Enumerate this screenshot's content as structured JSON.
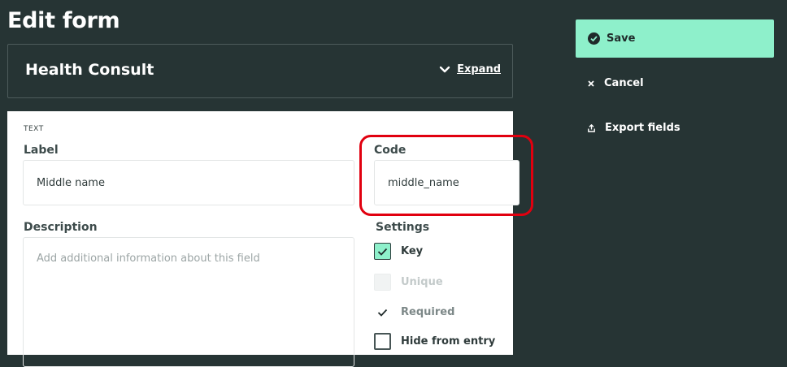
{
  "page": {
    "title": "Edit form"
  },
  "form": {
    "name": "Health Consult",
    "expand_label": "Expand"
  },
  "field": {
    "type_tag": "TEXT",
    "label_heading": "Label",
    "label_value": "Middle name",
    "code_heading": "Code",
    "code_value": "middle_name",
    "description_heading": "Description",
    "description_placeholder": "Add additional information about this field"
  },
  "settings": {
    "heading": "Settings",
    "items": [
      {
        "label": "Key",
        "checked": true,
        "disabled": false
      },
      {
        "label": "Unique",
        "checked": false,
        "disabled": true
      },
      {
        "label": "Required",
        "checked": true,
        "disabled": false
      },
      {
        "label": "Hide from entry",
        "checked": false,
        "disabled": false
      }
    ]
  },
  "sidebar": {
    "save_label": "Save",
    "cancel_label": "Cancel",
    "export_label": "Export fields"
  },
  "colors": {
    "background": "#263434",
    "accent": "#8ef0cb",
    "highlight": "#e1000f"
  }
}
